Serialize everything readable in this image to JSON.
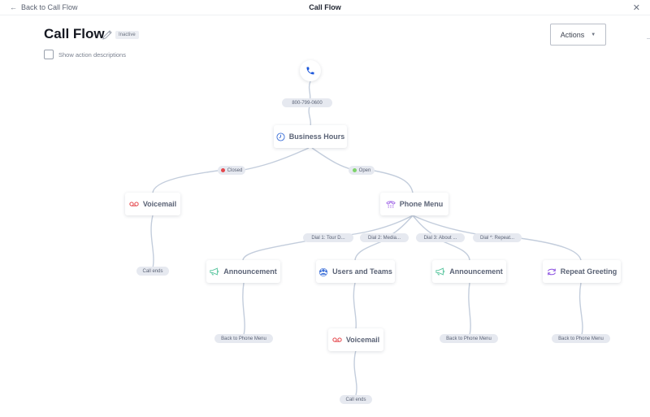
{
  "topbar": {
    "back_label": "Back to Call Flow",
    "title": "Call Flow",
    "close_icon": "close-icon"
  },
  "header": {
    "title": "Call Flow",
    "status": "Inactive",
    "show_descriptions_label": "Show action descriptions",
    "show_descriptions_checked": false,
    "actions_label": "Actions"
  },
  "colors": {
    "edge": "#c3cddc",
    "phone_blue": "#1a56db",
    "closed_red": "#e5484d",
    "open_green": "#7ed36b",
    "voicemail_red": "#e5484d",
    "announcement_green": "#5cc6a0",
    "phone_menu_purple": "#9b5de5",
    "users_blue": "#3b6fd8",
    "repeat_purple": "#8a4fe0"
  },
  "flow": {
    "start": {
      "icon": "phone-icon"
    },
    "number": "800-799-0600",
    "business_hours": {
      "label": "Business Hours",
      "icon": "clock-icon"
    },
    "branches": {
      "closed": "Closed",
      "open": "Open"
    },
    "voicemail_closed": {
      "label": "Voicemail",
      "icon": "voicemail-icon",
      "end": "Call ends"
    },
    "phone_menu": {
      "label": "Phone Menu",
      "icon": "phone-menu-icon"
    },
    "dial_options": [
      {
        "label": "Dial 1: Tour D...",
        "node": "Announcement",
        "icon": "megaphone-icon",
        "end": "Back to Phone Menu"
      },
      {
        "label": "Dial 2: Media...",
        "node": "Users and Teams",
        "icon": "users-teams-icon"
      },
      {
        "label": "Dial 3: About ...",
        "node": "Announcement",
        "icon": "megaphone-icon",
        "end": "Back to Phone Menu"
      },
      {
        "label": "Dial *: Repeat...",
        "node": "Repeat Greeting",
        "icon": "repeat-icon",
        "end": "Back to Phone Menu"
      }
    ],
    "voicemail_users": {
      "label": "Voicemail",
      "icon": "voicemail-icon",
      "end": "Call ends"
    }
  }
}
